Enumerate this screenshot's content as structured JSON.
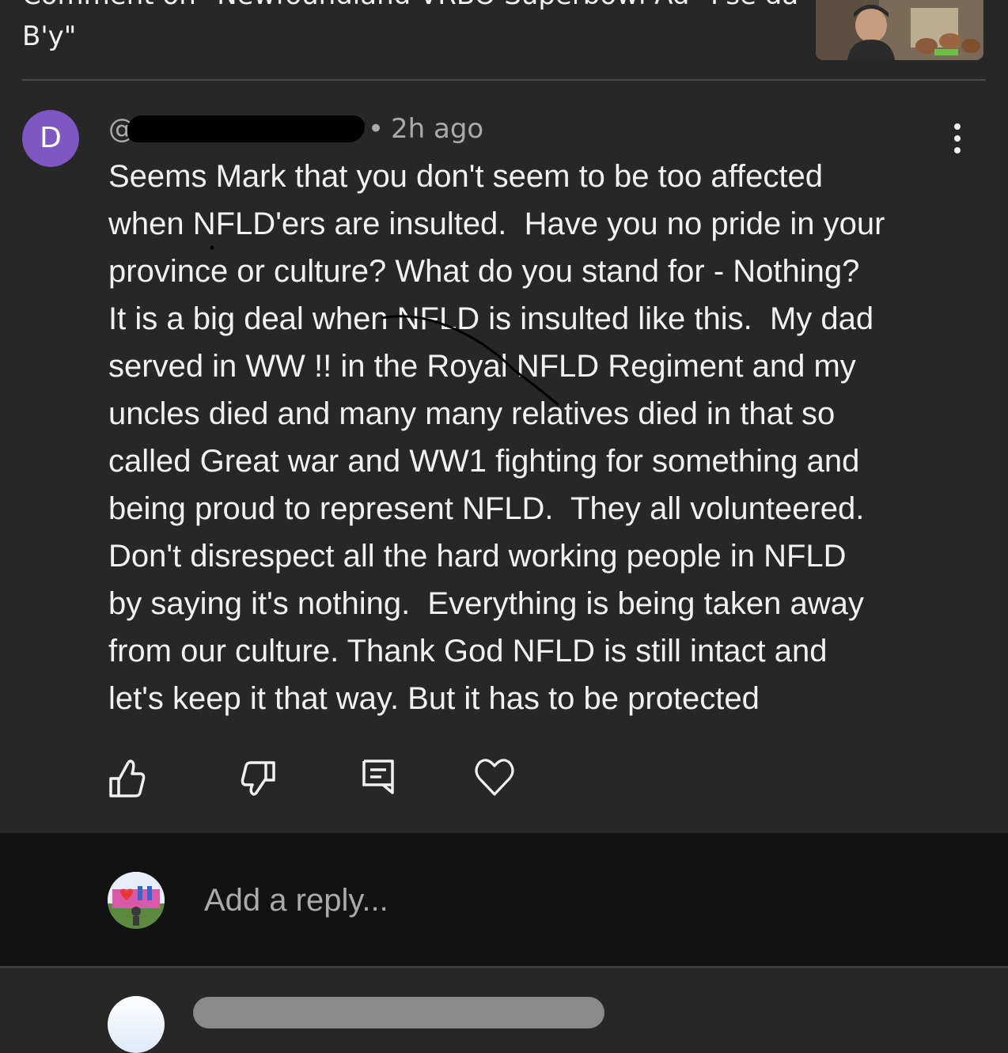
{
  "header": {
    "title": "Comment on \"Newfoundland VRBO Superbowl Ad \"I'se da B'y\""
  },
  "comment": {
    "avatar_letter": "D",
    "handle_prefix": "@",
    "separator": "•",
    "time": "2h ago",
    "body": "Seems Mark that you don't seem to be too affected\nwhen NFLD'ers are insulted.  Have you no pride in your\nprovince or culture? What do you stand for - Nothing?\nIt is a big deal when NFLD is insulted like this.  My dad\nserved in WW !! in the Royal NFLD Regiment and my\nuncles died and many many relatives died in that so\ncalled Great war and WW1 fighting for something and\nbeing proud to represent NFLD.  They all volunteered.\nDon't disrespect all the hard working people in NFLD\nby saying it's nothing.  Everything is being taken away\nfrom our culture. Thank God NFLD is still intact and\nlet's keep it that way. But it has to be protected"
  },
  "actions": {
    "like_icon": "thumb-up-icon",
    "dislike_icon": "thumb-down-icon",
    "reply_icon": "comment-icon",
    "heart_icon": "heart-icon"
  },
  "reply": {
    "placeholder": "Add a reply..."
  },
  "colors": {
    "background": "#272727",
    "reply_panel": "#121212",
    "avatar": "#7e57c2",
    "text": "#f1f1f1",
    "muted": "#aaaaaa"
  }
}
